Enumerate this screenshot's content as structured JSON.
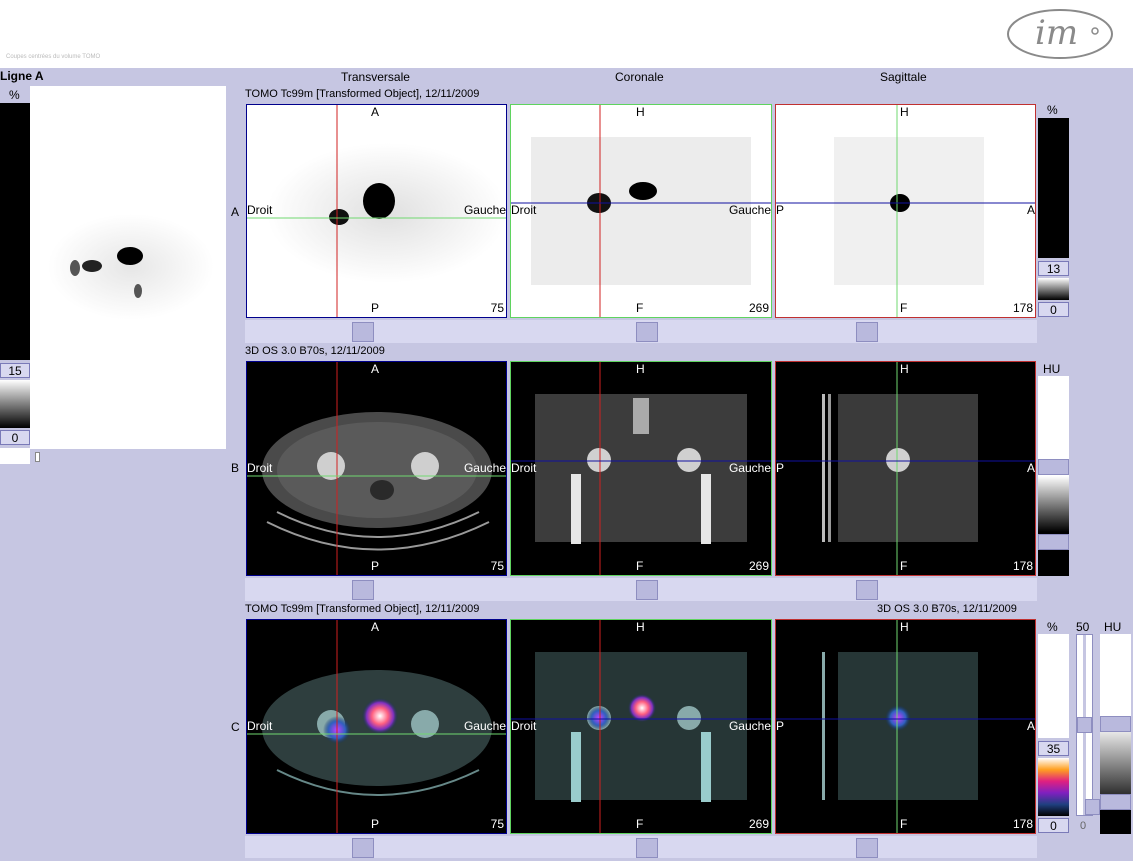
{
  "header": {
    "caption": "Coupes centrées du volume TOMO"
  },
  "left_panel": {
    "title": "Ligne A",
    "unit": "%",
    "index": "1",
    "scale_max": "15",
    "scale_min": "0"
  },
  "columns": {
    "transverse": "Transversale",
    "coronal": "Coronale",
    "sagittal": "Sagittale"
  },
  "rows": {
    "a": {
      "letter": "A",
      "series": "TOMO Tc99m [Transformed Object], 12/11/2009",
      "scale_unit": "%",
      "scale_max": "13",
      "scale_min": "0"
    },
    "b": {
      "letter": "B",
      "series": "3D OS  3.0  B70s, 12/11/2009",
      "scale_unit": "HU"
    },
    "c": {
      "letter": "C",
      "series_left": "TOMO Tc99m [Transformed Object], 12/11/2009",
      "series_right": "3D OS  3.0  B70s, 12/11/2009",
      "scale_unit": "%",
      "scale_max": "35",
      "scale_min": "0",
      "mix_top": "50",
      "mix_bottom": "0",
      "hu_unit": "HU"
    }
  },
  "orientation": {
    "anterior": "A",
    "posterior": "P",
    "head": "H",
    "foot": "F",
    "right": "Droit",
    "left": "Gauche"
  },
  "slices": {
    "transverse": "75",
    "coronal": "269",
    "sagittal": "178"
  },
  "colors": {
    "transverse_frame": "#00008c",
    "coronal_frame": "#5fd35f",
    "sagittal_frame": "#c03030",
    "cursor_red": "#d02020",
    "cursor_green": "#70d870",
    "cursor_blue": "#1010a0"
  }
}
